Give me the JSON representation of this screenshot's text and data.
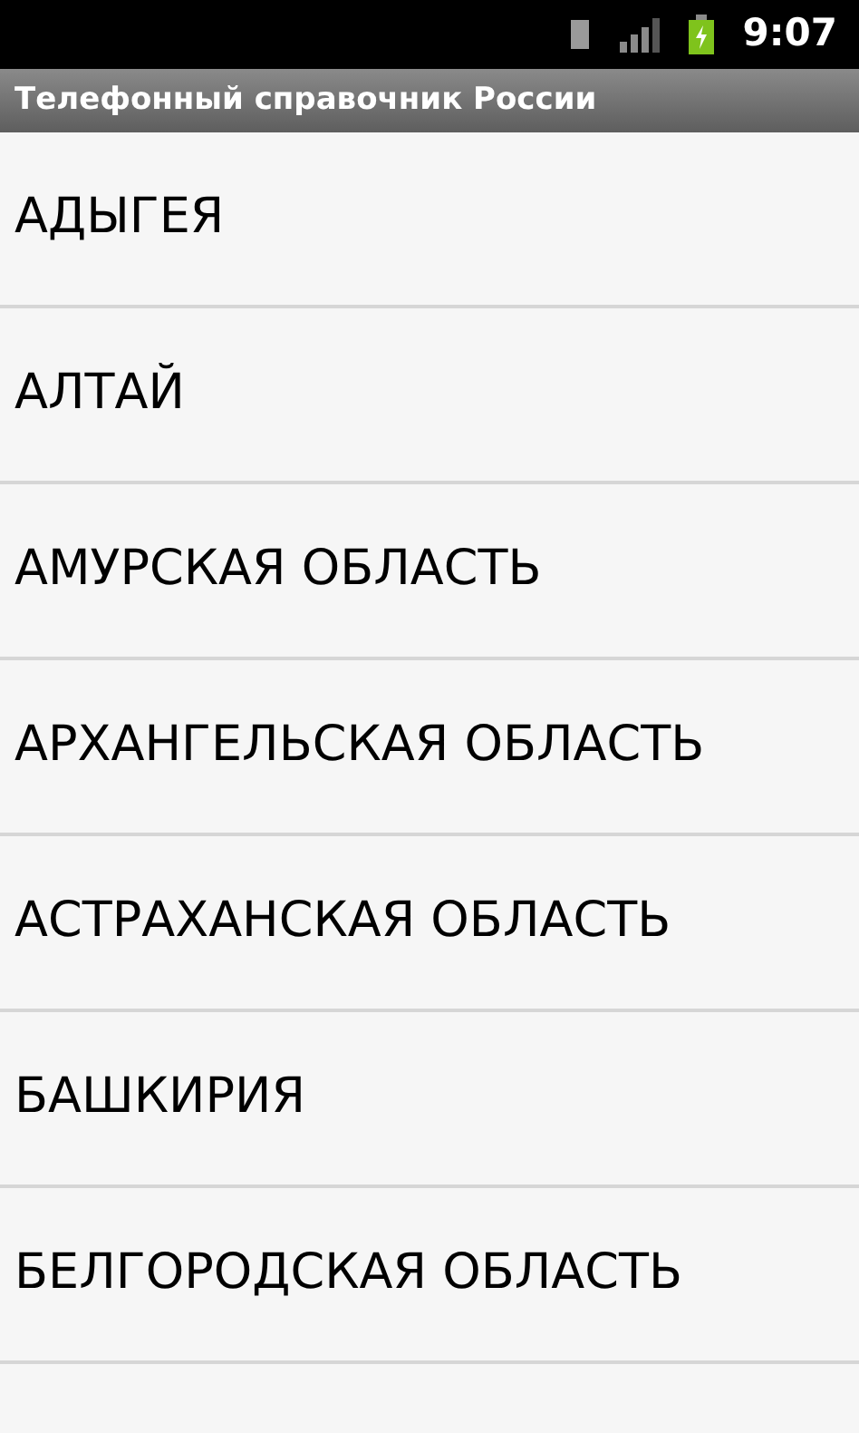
{
  "status_bar": {
    "time": "9:07"
  },
  "title": "Телефонный справочник России",
  "items": [
    "АДЫГЕЯ",
    "АЛТАЙ",
    "АМУРСКАЯ ОБЛАСТЬ",
    "АРХАНГЕЛЬСКАЯ ОБЛАСТЬ",
    "АСТРАХАНСКАЯ ОБЛАСТЬ",
    "БАШКИРИЯ",
    "БЕЛГОРОДСКАЯ ОБЛАСТЬ"
  ]
}
